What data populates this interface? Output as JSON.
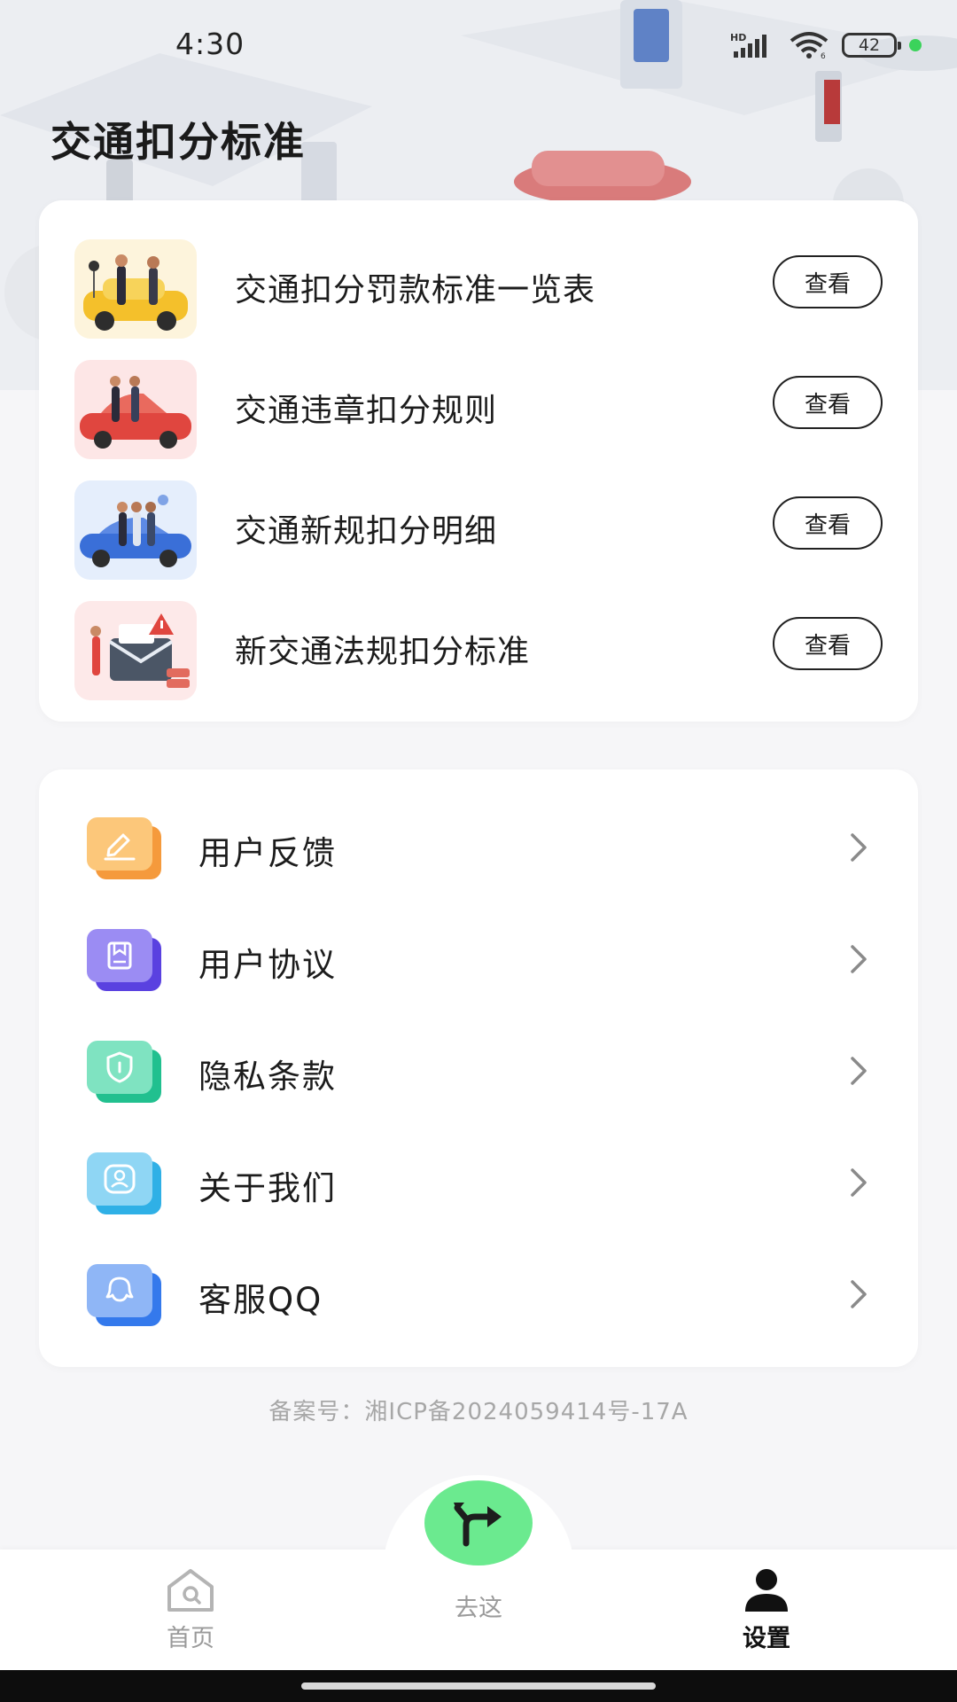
{
  "status_bar": {
    "time": "4:30",
    "network": "HD",
    "battery": "42"
  },
  "header": {
    "title": "交通扣分标准"
  },
  "rules": {
    "items": [
      {
        "label": "交通扣分罚款标准一览表",
        "button": "查看",
        "thumb_color": "#fdf4dc"
      },
      {
        "label": "交通违章扣分规则",
        "button": "查看",
        "thumb_color": "#fde6e6"
      },
      {
        "label": "交通新规扣分明细",
        "button": "查看",
        "thumb_color": "#e5eefc"
      },
      {
        "label": "新交通法规扣分标准",
        "button": "查看",
        "thumb_color": "#fde9e9"
      }
    ]
  },
  "menu": {
    "items": [
      {
        "label": "用户反馈",
        "icon": "edit-icon",
        "color": "#f59a3c"
      },
      {
        "label": "用户协议",
        "icon": "document-icon",
        "color": "#6a55e8"
      },
      {
        "label": "隐私条款",
        "icon": "shield-icon",
        "color": "#2cc99a"
      },
      {
        "label": "关于我们",
        "icon": "user-icon",
        "color": "#3cb4e6"
      },
      {
        "label": "客服QQ",
        "icon": "qq-icon",
        "color": "#3f86ee"
      }
    ]
  },
  "footer": {
    "icp": "备案号：湘ICP备2024059414号-17A"
  },
  "tab_bar": {
    "home": "首页",
    "go": "去这",
    "settings": "设置",
    "active": "settings",
    "fab_color": "#6bea8f"
  }
}
